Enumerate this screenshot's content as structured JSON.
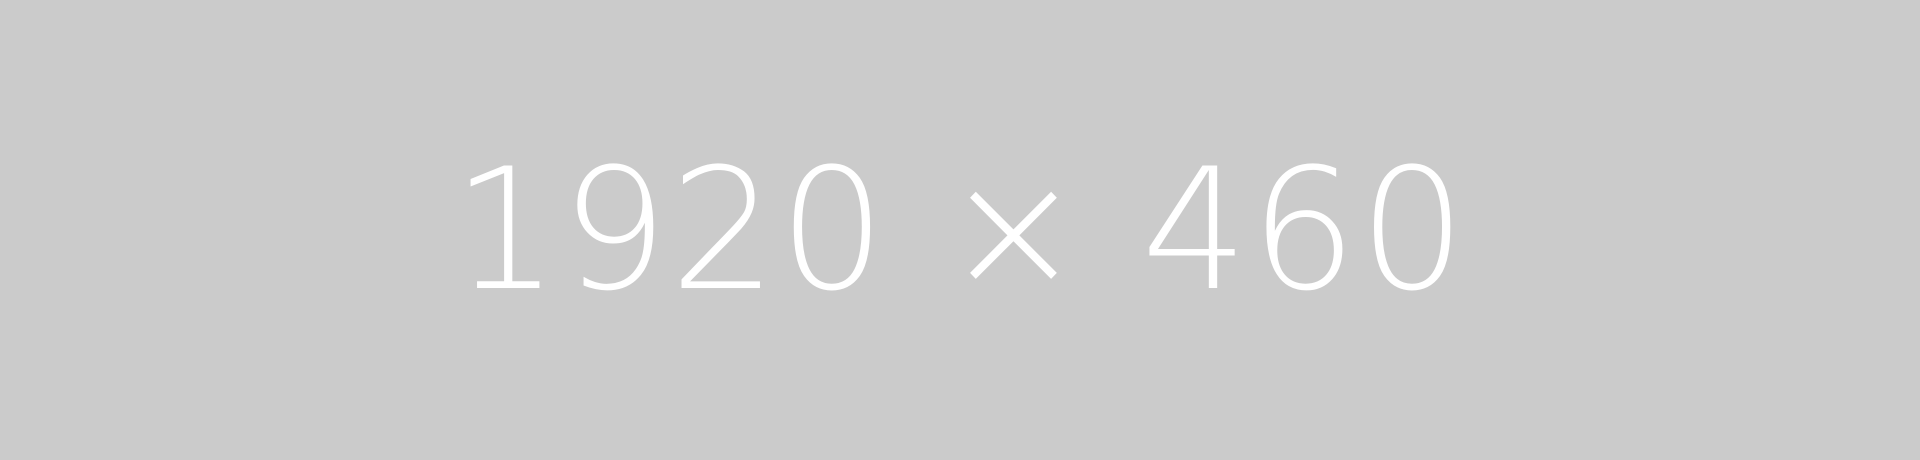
{
  "placeholder": {
    "label": "1920 × 460",
    "background_color": "#cbcbcb",
    "text_color": "#ffffff"
  }
}
